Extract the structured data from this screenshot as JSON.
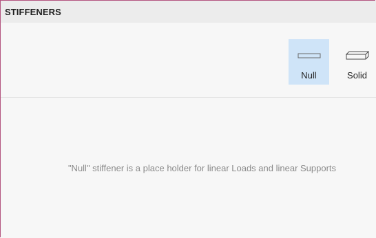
{
  "panel": {
    "title": "STIFFENERS"
  },
  "options": [
    {
      "label": "Null",
      "icon": "flat-plate-icon",
      "selected": true
    },
    {
      "label": "Solid",
      "icon": "solid-block-icon",
      "selected": false
    }
  ],
  "hint": {
    "text": "\"Null\" stiffener is a place holder for linear Loads and linear Supports"
  },
  "colors": {
    "selected_bg": "#cfe4f8",
    "border_accent": "#b3547f"
  }
}
